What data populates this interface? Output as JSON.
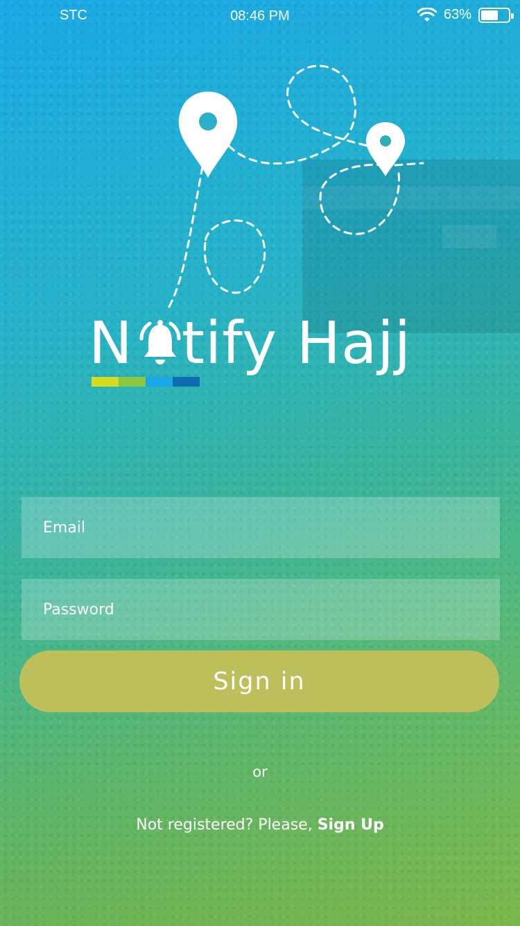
{
  "status_bar": {
    "carrier": "STC",
    "time": "08:46 PM",
    "battery_percent": "63%",
    "battery_level": 0.63,
    "icons": [
      "wifi-icon",
      "battery-icon"
    ]
  },
  "logo": {
    "letter_n": "N",
    "rest": "tify Hajj",
    "bell_icon": "bell-icon",
    "pin_icon": "map-pin-icon",
    "color_bar": [
      "#d8dc1e",
      "#8cc63e",
      "#1aa8e8",
      "#0b6cb5"
    ]
  },
  "form": {
    "email_placeholder": "Email",
    "password_placeholder": "Password",
    "signin_label": "Sign in",
    "signin_color": "#bdbf5a"
  },
  "footer": {
    "or_label": "or",
    "prompt_text": "Not registered? Please, ",
    "signup_label": "Sign Up"
  },
  "colors": {
    "gradient_top": "#1aa9e6",
    "gradient_bottom": "#84c24e"
  }
}
